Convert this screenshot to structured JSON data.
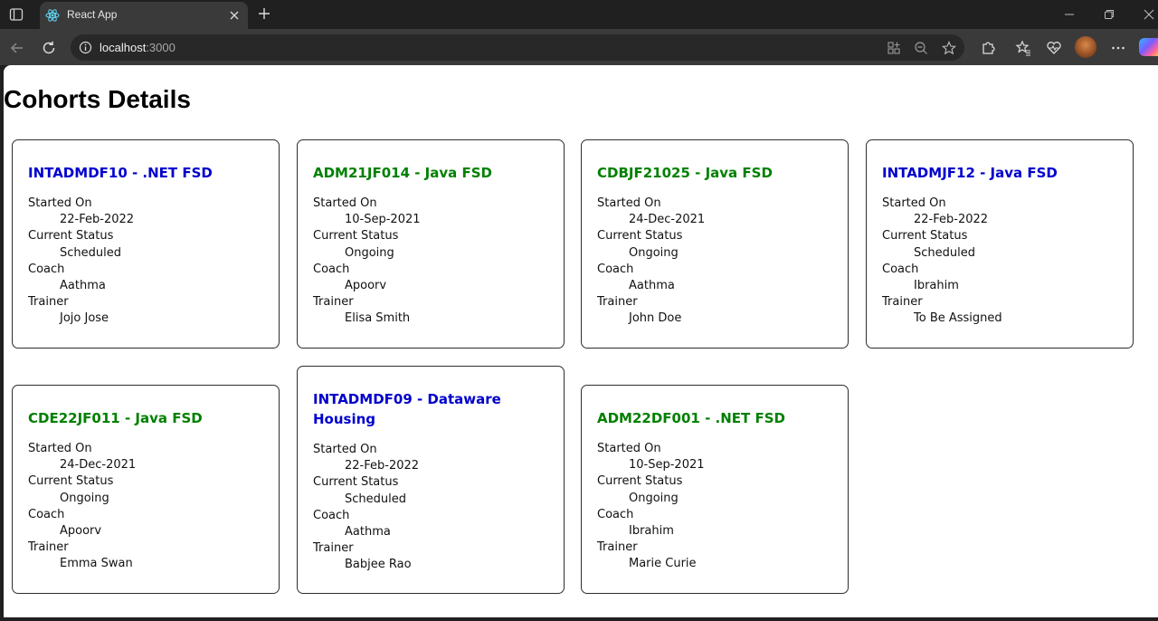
{
  "browser": {
    "tab_title": "React App",
    "url_host": "localhost",
    "url_port": ":3000"
  },
  "page": {
    "title": "Cohorts Details",
    "field_labels": {
      "started_on": "Started On",
      "current_status": "Current Status",
      "coach": "Coach",
      "trainer": "Trainer"
    }
  },
  "colors": {
    "scheduled": "#0000cd",
    "ongoing": "#008000"
  },
  "cohorts": [
    {
      "code": "INTADMDF10",
      "technology": ".NET FSD",
      "title": "INTADMDF10 - .NET FSD",
      "started_on": "22-Feb-2022",
      "status": "Scheduled",
      "coach": "Aathma",
      "trainer": "Jojo Jose"
    },
    {
      "code": "ADM21JF014",
      "technology": "Java FSD",
      "title": "ADM21JF014 - Java FSD",
      "started_on": "10-Sep-2021",
      "status": "Ongoing",
      "coach": "Apoorv",
      "trainer": "Elisa Smith"
    },
    {
      "code": "CDBJF21025",
      "technology": "Java FSD",
      "title": "CDBJF21025 - Java FSD",
      "started_on": "24-Dec-2021",
      "status": "Ongoing",
      "coach": "Aathma",
      "trainer": "John Doe"
    },
    {
      "code": "INTADMJF12",
      "technology": "Java FSD",
      "title": "INTADMJF12 - Java FSD",
      "started_on": "22-Feb-2022",
      "status": "Scheduled",
      "coach": "Ibrahim",
      "trainer": "To Be Assigned"
    },
    {
      "code": "CDE22JF011",
      "technology": "Java FSD",
      "title": "CDE22JF011 - Java FSD",
      "started_on": "24-Dec-2021",
      "status": "Ongoing",
      "coach": "Apoorv",
      "trainer": "Emma Swan"
    },
    {
      "code": "INTADMDF09",
      "technology": "Dataware Housing",
      "title": "INTADMDF09 - Dataware Housing",
      "started_on": "22-Feb-2022",
      "status": "Scheduled",
      "coach": "Aathma",
      "trainer": "Babjee Rao"
    },
    {
      "code": "ADM22DF001",
      "technology": ".NET FSD",
      "title": "ADM22DF001 - .NET FSD",
      "started_on": "10-Sep-2021",
      "status": "Ongoing",
      "coach": "Ibrahim",
      "trainer": "Marie Curie"
    }
  ]
}
